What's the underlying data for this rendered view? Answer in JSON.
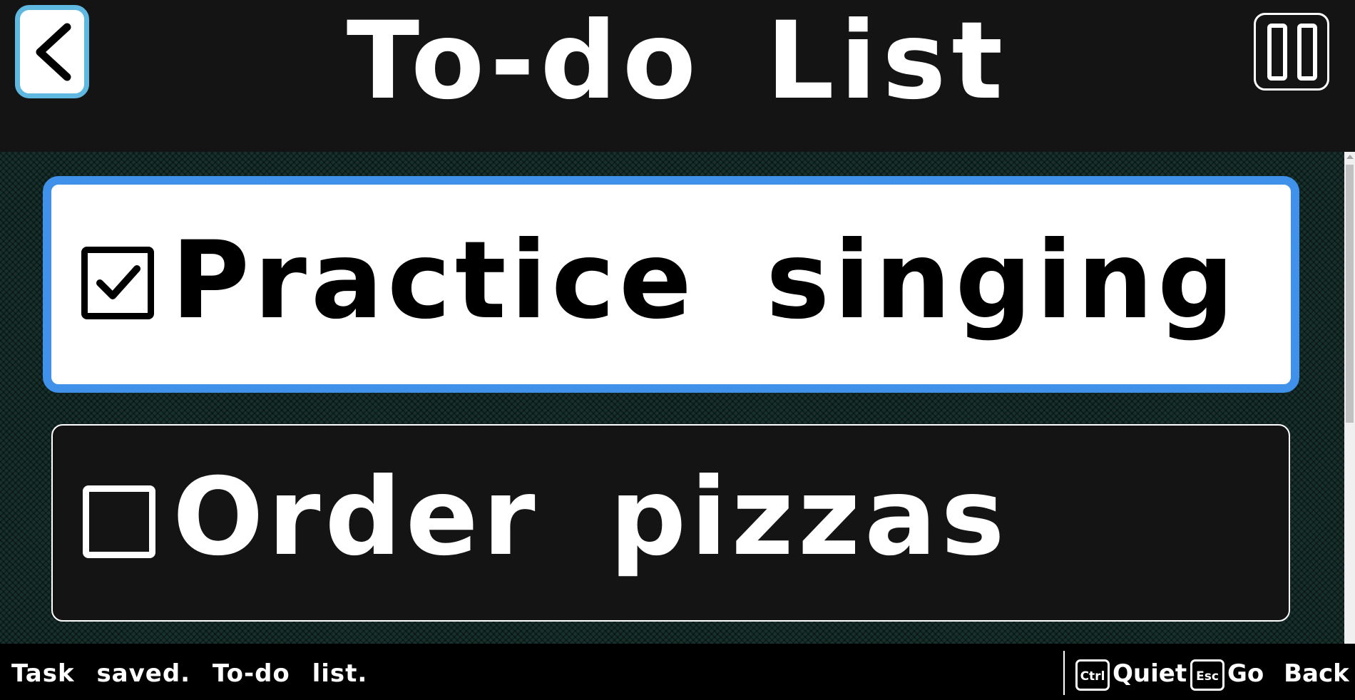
{
  "header": {
    "title": "To-do List",
    "back_icon": "chevron-left-icon",
    "pause_icon": "pause-icon"
  },
  "tasks": [
    {
      "label": "Practice singing",
      "checked": true,
      "selected": true
    },
    {
      "label": "Order pizzas",
      "checked": false,
      "selected": false
    }
  ],
  "status": {
    "message": "Task saved. To-do list.",
    "hints": [
      {
        "key": "Ctrl",
        "label": "Quiet"
      },
      {
        "key": "Esc",
        "label": "Go Back"
      }
    ]
  },
  "colors": {
    "accent_border": "#3f91ea",
    "back_button_border": "#5fb8e0",
    "background_pattern": "#17312c"
  }
}
